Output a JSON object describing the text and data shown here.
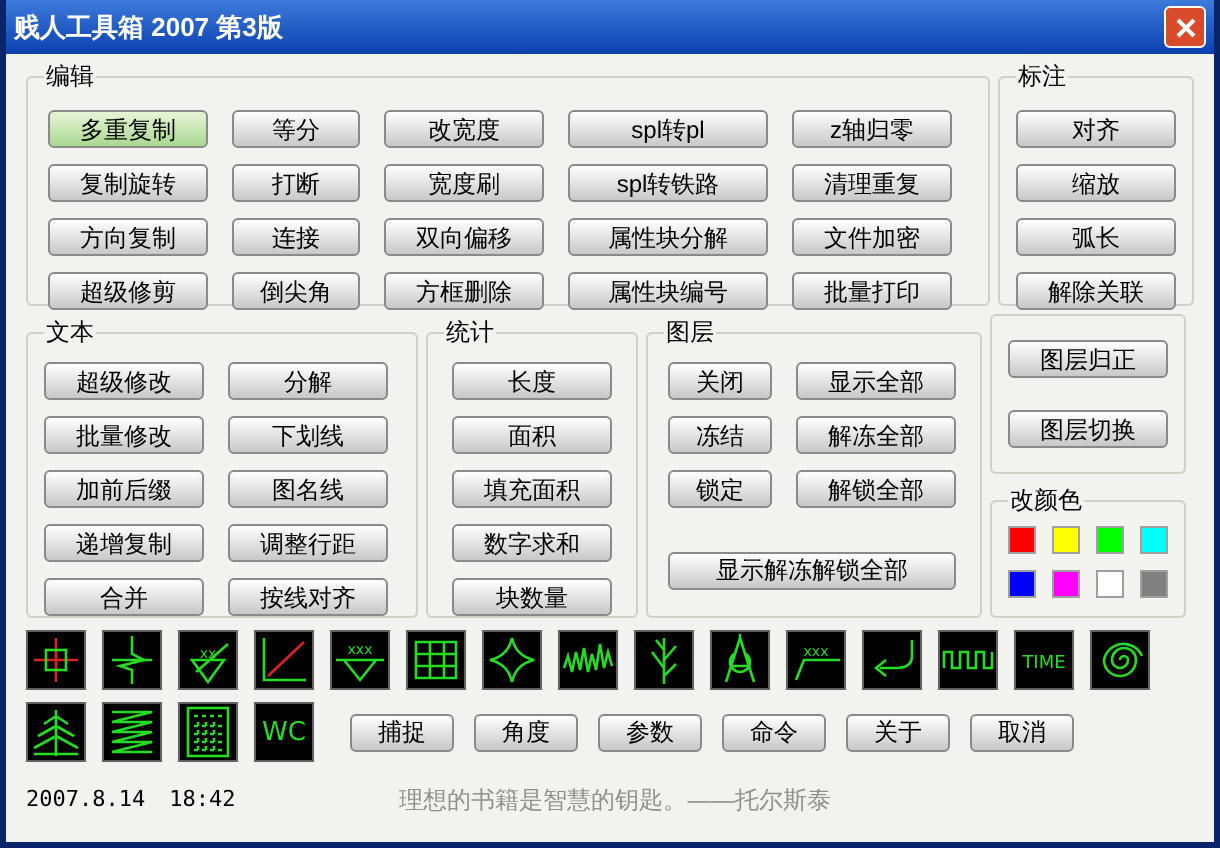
{
  "window": {
    "title": "贱人工具箱 2007 第3版"
  },
  "edit": {
    "title": "编辑",
    "buttons": [
      {
        "label": "多重复制",
        "highlighted": true
      },
      {
        "label": "等分",
        "highlighted": false
      },
      {
        "label": "改宽度",
        "highlighted": false
      },
      {
        "label": "spl转pl",
        "highlighted": false
      },
      {
        "label": "z轴归零",
        "highlighted": false
      },
      {
        "label": "复制旋转",
        "highlighted": false
      },
      {
        "label": "打断",
        "highlighted": false
      },
      {
        "label": "宽度刷",
        "highlighted": false
      },
      {
        "label": "spl转铁路",
        "highlighted": false
      },
      {
        "label": "清理重复",
        "highlighted": false
      },
      {
        "label": "方向复制",
        "highlighted": false
      },
      {
        "label": "连接",
        "highlighted": false
      },
      {
        "label": "双向偏移",
        "highlighted": false
      },
      {
        "label": "属性块分解",
        "highlighted": false
      },
      {
        "label": "文件加密",
        "highlighted": false
      },
      {
        "label": "超级修剪",
        "highlighted": false
      },
      {
        "label": "倒尖角",
        "highlighted": false
      },
      {
        "label": "方框删除",
        "highlighted": false
      },
      {
        "label": "属性块编号",
        "highlighted": false
      },
      {
        "label": "批量打印",
        "highlighted": false
      }
    ]
  },
  "annotate": {
    "title": "标注",
    "buttons": [
      "对齐",
      "缩放",
      "弧长",
      "解除关联"
    ]
  },
  "text": {
    "title": "文本",
    "buttons": [
      "超级修改",
      "分解",
      "批量修改",
      "下划线",
      "加前后缀",
      "图名线",
      "递增复制",
      "调整行距",
      "合并",
      "按线对齐"
    ]
  },
  "stats": {
    "title": "统计",
    "buttons": [
      "长度",
      "面积",
      "填充面积",
      "数字求和",
      "块数量"
    ]
  },
  "layers": {
    "title": "图层",
    "buttons": [
      "关闭",
      "显示全部",
      "冻结",
      "解冻全部",
      "锁定",
      "解锁全部"
    ],
    "wide_button": "显示解冻解锁全部"
  },
  "layer_tools": {
    "buttons": [
      "图层归正",
      "图层切换"
    ]
  },
  "colors": {
    "title": "改颜色",
    "swatches": [
      {
        "color": "#ff0000"
      },
      {
        "color": "#ffff00"
      },
      {
        "color": "#00ff00"
      },
      {
        "color": "#00ffff"
      },
      {
        "color": "#0000ff"
      },
      {
        "color": "#ff00ff"
      },
      {
        "color": "#ffffff"
      },
      {
        "color": "#808080"
      }
    ]
  },
  "tiles": [
    {
      "kind": "crosshair"
    },
    {
      "kind": "breakline"
    },
    {
      "kind": "mark",
      "label": "xx"
    },
    {
      "kind": "diagonal"
    },
    {
      "kind": "level",
      "label": "xxx"
    },
    {
      "kind": "table"
    },
    {
      "kind": "star"
    },
    {
      "kind": "noise"
    },
    {
      "kind": "tree"
    },
    {
      "kind": "compass"
    },
    {
      "kind": "leader",
      "label": "xxx"
    },
    {
      "kind": "arrow"
    },
    {
      "kind": "zigzag"
    },
    {
      "kind": "word",
      "label": "TIME"
    },
    {
      "kind": "spiral"
    },
    {
      "kind": "pine"
    },
    {
      "kind": "spring"
    },
    {
      "kind": "calculator"
    },
    {
      "kind": "word",
      "label": "WC"
    }
  ],
  "buttons": [
    "捕捉",
    "角度",
    "参数",
    "命令",
    "关于",
    "取消"
  ],
  "status": {
    "date": "2007.8.14",
    "time": "18:42",
    "quote": "理想的书籍是智慧的钥匙。——托尔斯泰"
  }
}
